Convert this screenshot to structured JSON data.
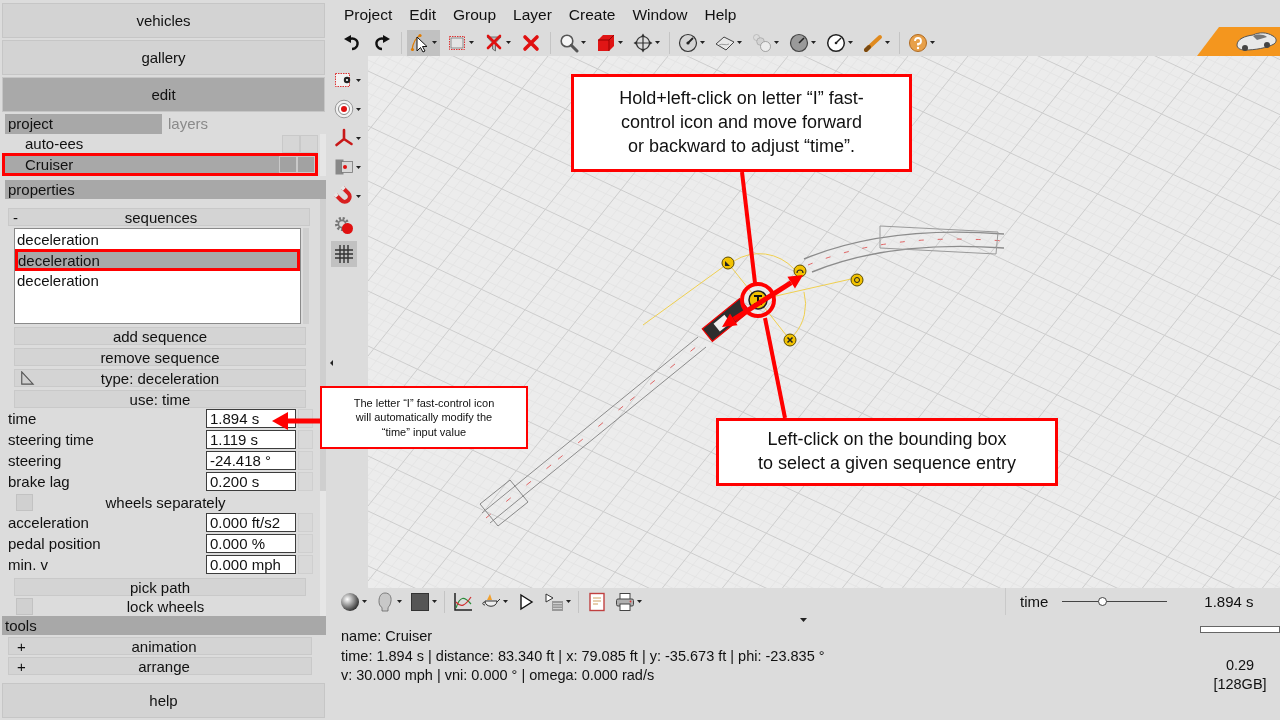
{
  "menu": [
    "Project",
    "Edit",
    "Group",
    "Layer",
    "Create",
    "Window",
    "Help"
  ],
  "toolbar": [
    [
      {
        "kind": "undo",
        "dropdown": false,
        "selected": false
      },
      {
        "kind": "redo",
        "dropdown": false,
        "selected": false
      }
    ],
    [
      {
        "kind": "select",
        "dropdown": true,
        "selected": true
      },
      {
        "kind": "rectangle",
        "dropdown": true,
        "selected": false
      },
      {
        "kind": "filter",
        "dropdown": true,
        "selected": false
      },
      {
        "kind": "delete",
        "dropdown": false,
        "selected": false
      }
    ],
    [
      {
        "kind": "zoom",
        "dropdown": true,
        "selected": false
      },
      {
        "kind": "cube",
        "dropdown": true,
        "selected": false
      },
      {
        "kind": "move",
        "dropdown": true,
        "selected": false
      }
    ],
    [
      {
        "kind": "gauge",
        "dropdown": true,
        "selected": false
      },
      {
        "kind": "sheet",
        "dropdown": true,
        "selected": false
      },
      {
        "kind": "spheres",
        "dropdown": true,
        "selected": false
      },
      {
        "kind": "dial",
        "dropdown": true,
        "selected": false
      },
      {
        "kind": "meter",
        "dropdown": true,
        "selected": false
      },
      {
        "kind": "stick",
        "dropdown": true,
        "selected": false
      }
    ],
    [
      {
        "kind": "help",
        "dropdown": true,
        "selected": false
      }
    ]
  ],
  "side_tools": [
    {
      "kind": "frame",
      "dropdown": true,
      "selected": false
    },
    {
      "kind": "target",
      "dropdown": true,
      "selected": false
    },
    {
      "kind": "axes",
      "dropdown": true,
      "selected": false
    },
    {
      "kind": "camera",
      "dropdown": true,
      "selected": false
    },
    {
      "kind": "magnet",
      "dropdown": true,
      "selected": false
    },
    {
      "kind": "settings",
      "dropdown": false,
      "selected": false
    },
    {
      "kind": "grid",
      "dropdown": false,
      "selected": true
    }
  ],
  "bottom_tools": [
    [
      {
        "kind": "sphere",
        "dropdown": true,
        "selected": false
      },
      {
        "kind": "head",
        "dropdown": true,
        "selected": false
      },
      {
        "kind": "square",
        "dropdown": true,
        "selected": false
      }
    ],
    [
      {
        "kind": "chart",
        "dropdown": false,
        "selected": false
      },
      {
        "kind": "teapot",
        "dropdown": true,
        "selected": false
      },
      {
        "kind": "play",
        "dropdown": false,
        "selected": false
      },
      {
        "kind": "playlist",
        "dropdown": true,
        "selected": false
      }
    ],
    [
      {
        "kind": "report",
        "dropdown": false,
        "selected": false
      },
      {
        "kind": "print",
        "dropdown": true,
        "selected": false
      }
    ]
  ],
  "left_panel": {
    "nav": [
      {
        "label": "vehicles",
        "selected": false
      },
      {
        "label": "gallery",
        "selected": false
      },
      {
        "label": "edit",
        "selected": true
      }
    ],
    "tabs": [
      {
        "label": "project",
        "selected": true,
        "disabled": false
      },
      {
        "label": "layers",
        "selected": false,
        "disabled": true
      }
    ],
    "project_items": [
      {
        "label": "auto-ees",
        "selected": false,
        "highlighted": false
      },
      {
        "label": "Cruiser",
        "selected": true,
        "highlighted": true
      }
    ],
    "properties": {
      "title": "properties",
      "rows": [
        {
          "kind": "section",
          "toggle": "-",
          "label": "sequences"
        },
        {
          "kind": "list",
          "items": [
            {
              "label": "deceleration",
              "selected": false,
              "highlighted": false
            },
            {
              "label": "deceleration",
              "selected": true,
              "highlighted": true
            },
            {
              "label": "deceleration",
              "selected": false,
              "highlighted": false
            }
          ]
        },
        {
          "kind": "button",
          "label": "add sequence"
        },
        {
          "kind": "button",
          "label": "remove sequence"
        },
        {
          "kind": "typebutton",
          "label": "type: deceleration"
        },
        {
          "kind": "button",
          "label": "use: time"
        },
        {
          "kind": "field",
          "label": "time",
          "value": "1.894 s"
        },
        {
          "kind": "field",
          "label": "steering time",
          "value": "1.119 s"
        },
        {
          "kind": "field",
          "label": "steering",
          "value": "-24.418 °"
        },
        {
          "kind": "field",
          "label": "brake lag",
          "value": "0.200 s"
        },
        {
          "kind": "checkbox",
          "label": "wheels separately",
          "checked": false
        },
        {
          "kind": "field",
          "label": "acceleration",
          "value": "0.000 ft/s2"
        },
        {
          "kind": "field",
          "label": "pedal position",
          "value": "0.000 %"
        },
        {
          "kind": "field",
          "label": "min. v",
          "value": "0.000 mph"
        },
        {
          "kind": "button",
          "label": "pick path"
        },
        {
          "kind": "checkbox",
          "label": "lock wheels",
          "checked": false
        }
      ]
    },
    "tools": {
      "title": "tools",
      "items": [
        {
          "toggle": "+",
          "label": "animation"
        },
        {
          "toggle": "+",
          "label": "arrange"
        }
      ]
    },
    "help": "help"
  },
  "time_slider": {
    "label": "time",
    "level": 0.38,
    "reading": "1.894 s"
  },
  "progress": {
    "level": 0
  },
  "status": {
    "lines": [
      "name: Cruiser",
      "time: 1.894 s | distance: 83.340 ft | x: 79.085 ft | y: -35.673 ft | phi: -23.835 °",
      "v: 30.000 mph | vni: 0.000 ° | omega: 0.000 rad/s"
    ],
    "memory": [
      "0.29",
      "[128GB]"
    ]
  },
  "annotations": [
    {
      "kind": "callout",
      "lines": [
        "Hold+left-click on letter “I” fast-",
        "control icon and move forward",
        "or backward to adjust “time”."
      ]
    },
    {
      "kind": "callout",
      "lines": [
        "Left-click on the bounding box",
        "to select a given sequence entry"
      ]
    },
    {
      "kind": "note",
      "lines": [
        "The letter “I” fast-control icon",
        "will automatically modify the",
        "“time” input value"
      ]
    }
  ]
}
